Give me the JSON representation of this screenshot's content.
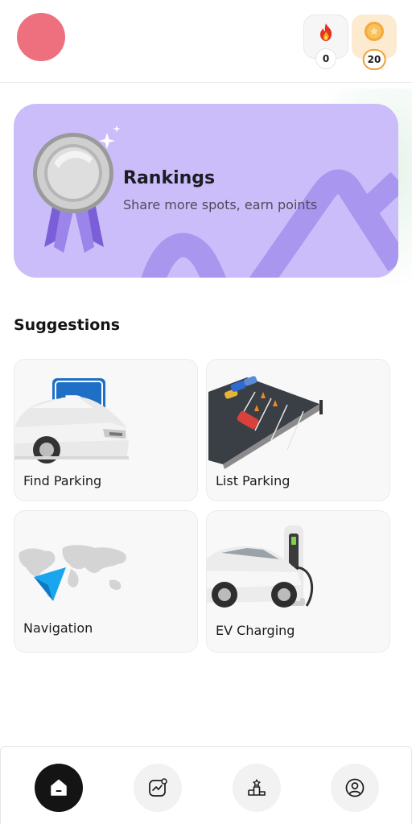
{
  "header": {
    "avatar_color": "#ee6f7d",
    "streak": {
      "icon": "fire-icon",
      "count": "0"
    },
    "coins": {
      "icon": "coin-star-icon",
      "count": "20"
    }
  },
  "banner": {
    "title": "Rankings",
    "subtitle": "Share more spots, earn points",
    "icon": "silver-medal-icon",
    "background_color": "#cbbdf9"
  },
  "suggestions": {
    "title": "Suggestions",
    "items": [
      {
        "label": "Find Parking",
        "icon": "car-parking-sign-image"
      },
      {
        "label": "List Parking",
        "icon": "parking-lot-image"
      },
      {
        "label": "Navigation",
        "icon": "world-map-pointer-image"
      },
      {
        "label": "EV Charging",
        "icon": "ev-charging-car-image"
      }
    ]
  },
  "bottom_nav": {
    "items": [
      {
        "icon": "home-icon",
        "active": true
      },
      {
        "icon": "activity-chart-icon",
        "active": false
      },
      {
        "icon": "leaderboard-podium-icon",
        "active": false
      },
      {
        "icon": "profile-icon",
        "active": false
      }
    ]
  }
}
